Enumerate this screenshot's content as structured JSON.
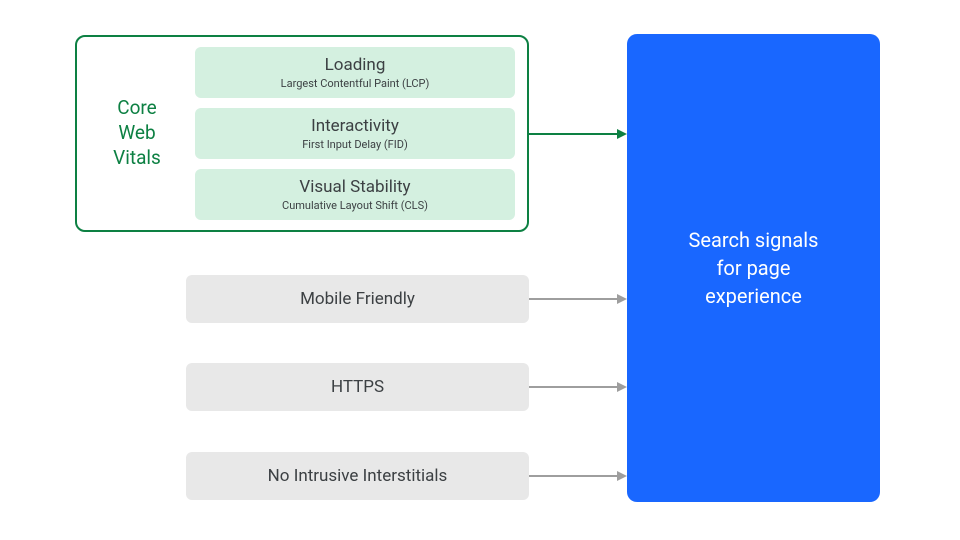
{
  "cwv": {
    "label1": "Core",
    "label2": "Web",
    "label3": "Vitals",
    "items": [
      {
        "title": "Loading",
        "sub": "Largest Contentful Paint (LCP)"
      },
      {
        "title": "Interactivity",
        "sub": "First Input Delay (FID)"
      },
      {
        "title": "Visual Stability",
        "sub": "Cumulative Layout Shift (CLS)"
      }
    ]
  },
  "signals": [
    {
      "label": "Mobile Friendly"
    },
    {
      "label": "HTTPS"
    },
    {
      "label": "No Intrusive Interstitials"
    }
  ],
  "target": {
    "line1": "Search signals",
    "line2": "for page",
    "line3": "experience"
  },
  "colors": {
    "green": "#0d8043",
    "grayArrow": "#9e9e9e",
    "blue": "#1967ff"
  }
}
